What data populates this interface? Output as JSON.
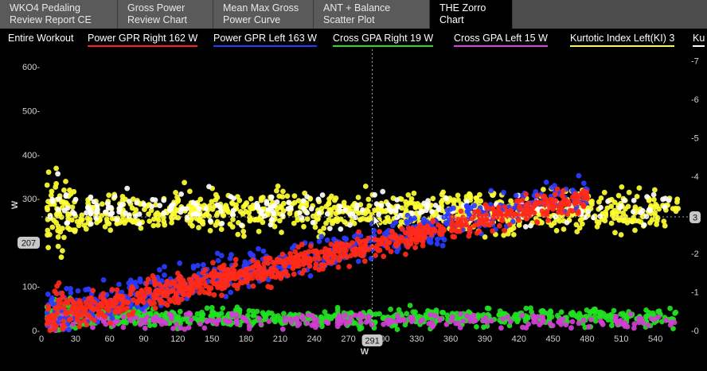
{
  "tabs": [
    {
      "label": "WKO4 Pedaling\nReview Report CE",
      "active": false
    },
    {
      "label": "Gross Power\nReview Chart",
      "active": false
    },
    {
      "label": "Mean Max Gross\nPower Curve",
      "active": false
    },
    {
      "label": "ANT + Balance\nScatter Plot",
      "active": false
    },
    {
      "label": "THE Zorro\nChart",
      "active": true
    }
  ],
  "legend": {
    "range_label": "Entire Workout",
    "items": [
      {
        "label": "Power GPR Right  162 W",
        "color": "#ff2020"
      },
      {
        "label": "Power GPR Left  163 W",
        "color": "#2040ff"
      },
      {
        "label": "Cross GPA Right  19 W",
        "color": "#20e020"
      },
      {
        "label": "Cross GPA Left  15 W",
        "color": "#e040e0"
      },
      {
        "label": "Kurtotic Index Left(KI)  3",
        "color": "#ffff30"
      },
      {
        "label": "Ku",
        "color": "#ffffff"
      }
    ]
  },
  "chart_data": {
    "type": "scatter",
    "xlabel": "W",
    "ylabel": "W",
    "x_ticks": [
      0,
      30,
      60,
      90,
      120,
      150,
      180,
      210,
      240,
      270,
      300,
      330,
      360,
      390,
      420,
      450,
      480,
      510,
      540
    ],
    "y_ticks": [
      0,
      100,
      200,
      300,
      400,
      500,
      600
    ],
    "y_ticks_labels": [
      "0-",
      "100-",
      "200-",
      "300-",
      "400-",
      "500-",
      "600-"
    ],
    "y2_ticks": [
      0,
      1,
      2,
      3,
      4,
      5,
      6,
      7
    ],
    "y2_ticks_labels": [
      "-0",
      "-1",
      "-2",
      "-3",
      "-4",
      "-5",
      "-6",
      "-7"
    ],
    "xlim": [
      0,
      570
    ],
    "ylim": [
      0,
      640
    ],
    "y2lim": [
      0,
      7.3
    ],
    "crosshair": {
      "x": 291,
      "y": 207,
      "x_label": "291",
      "y_label": "207",
      "y2_label": "3"
    },
    "series": [
      {
        "name": "Power GPR Right",
        "color": "#ff2a1a",
        "shape": "linear band",
        "x_range": [
          5,
          480
        ],
        "slope": 0.58,
        "intercept": 25,
        "spread": 22
      },
      {
        "name": "Power GPR Left",
        "color": "#2a3cff",
        "shape": "linear band",
        "x_range": [
          5,
          480
        ],
        "slope": 0.6,
        "intercept": 30,
        "spread": 30
      },
      {
        "name": "Cross GPA Right",
        "color": "#22e022",
        "shape": "flat band",
        "x_range": [
          5,
          560
        ],
        "level": 30,
        "spread": 14
      },
      {
        "name": "Cross GPA Left",
        "color": "#d040d0",
        "shape": "flat band",
        "x_range": [
          5,
          560
        ],
        "level": 22,
        "spread": 12
      },
      {
        "name": "Kurtotic Index Left(KI)",
        "color": "#ffff33",
        "shape": "flat band",
        "x_range": [
          5,
          560
        ],
        "level": 270,
        "spread": 30
      },
      {
        "name": "Ku",
        "color": "#ffffff",
        "shape": "flat band",
        "x_range": [
          5,
          560
        ],
        "level": 275,
        "spread": 25
      }
    ]
  }
}
